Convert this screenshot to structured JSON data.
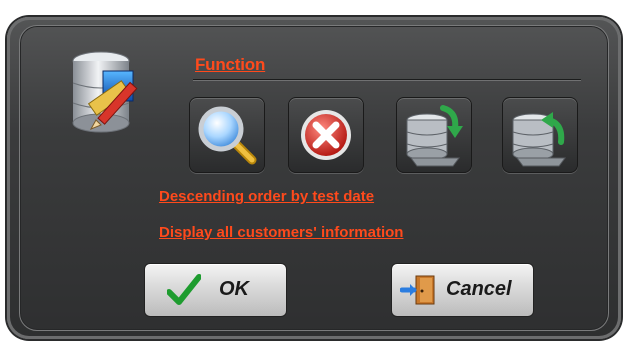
{
  "dialog": {
    "section_title": "Function",
    "links": {
      "descending_order": "Descending order by test date",
      "display_all": "Display all customers' information"
    },
    "buttons": {
      "ok_label": "OK",
      "cancel_label": "Cancel"
    },
    "tools": [
      {
        "icon": "magnifier-search-icon"
      },
      {
        "icon": "delete-x-icon"
      },
      {
        "icon": "database-import-icon"
      },
      {
        "icon": "database-export-icon"
      }
    ]
  },
  "colors": {
    "accent_text": "#ff4a1c",
    "dialog_bg": "#3b3c3d"
  }
}
